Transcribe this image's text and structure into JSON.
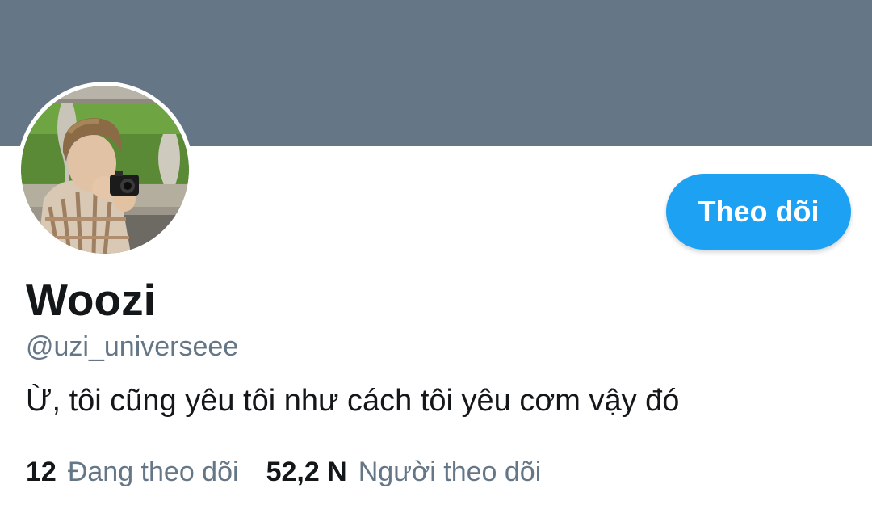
{
  "colors": {
    "banner": "#657786",
    "accent": "#1da1f2",
    "primary_text": "#14171a",
    "secondary_text": "#657786"
  },
  "profile": {
    "avatar": "profile-photo",
    "display_name": "Woozi",
    "handle": "@uzi_universeee",
    "bio": "Ừ, tôi cũng yêu tôi như cách tôi yêu cơm vậy đó"
  },
  "actions": {
    "follow_label": "Theo dõi"
  },
  "stats": {
    "following_count": "12",
    "following_label": "Đang theo dõi",
    "followers_count": "52,2 N",
    "followers_label": "Người theo dõi"
  }
}
